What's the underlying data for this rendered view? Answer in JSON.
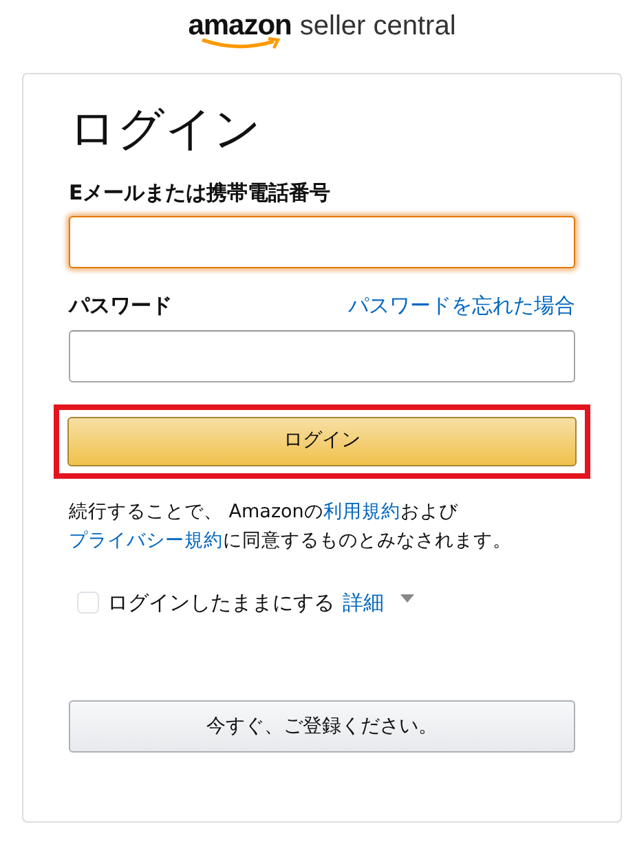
{
  "logo": {
    "brand": "amazon",
    "product": "seller central"
  },
  "title": "ログイン",
  "fields": [
    {
      "label": "Eメールまたは携帯電話番号",
      "focused": true
    },
    {
      "label": "パスワード",
      "link": "パスワードを忘れた場合",
      "focused": false
    }
  ],
  "submit": {
    "label": "ログイン",
    "highlighted": true
  },
  "terms": [
    {
      "text": "続行することで、 Amazonの",
      "link": false
    },
    {
      "text": "利用規約",
      "link": true
    },
    {
      "text": "および",
      "link": false
    },
    {
      "text": "プライバシー規約",
      "link": true
    },
    {
      "text": "に同意するものとみなされます。",
      "link": false
    }
  ],
  "remember": {
    "label": "ログインしたままにする",
    "checked": false,
    "details": "詳細"
  },
  "register": {
    "label": "今すぐ、ご登録ください。"
  }
}
